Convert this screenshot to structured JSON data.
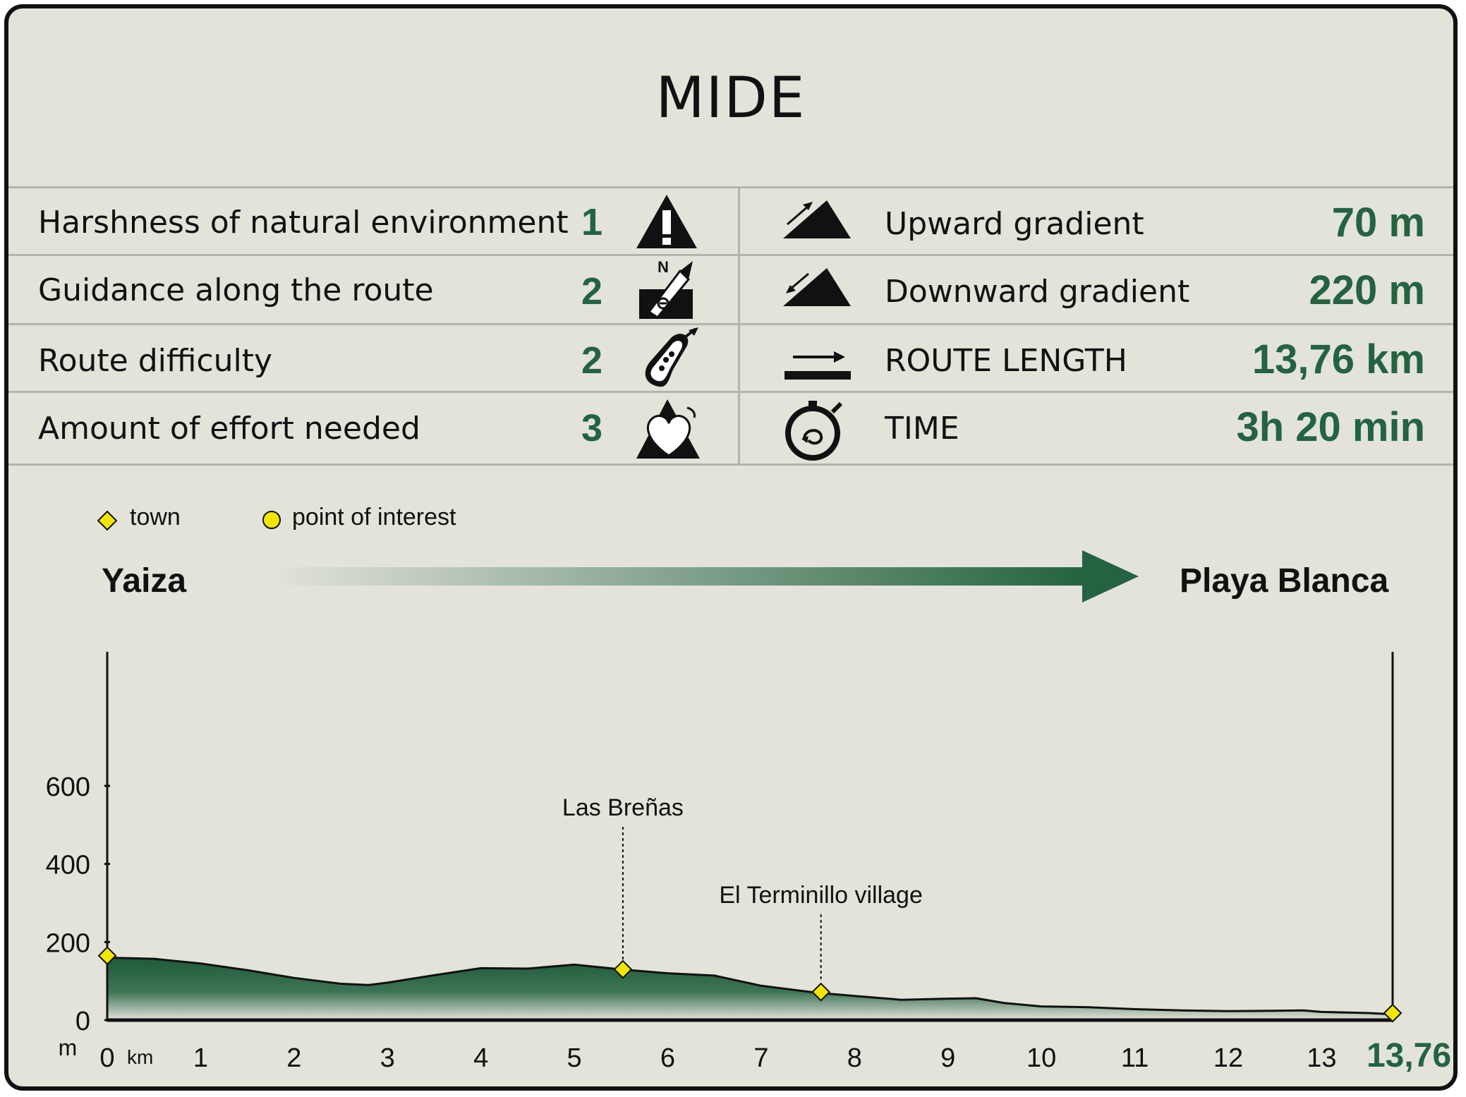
{
  "title": "MIDE",
  "mide_rows": [
    {
      "label": "Harshness of natural environment",
      "value": "1",
      "icon": "warning-triangle-icon"
    },
    {
      "label": "Guidance along the route",
      "value": "2",
      "icon": "compass-signpost-icon"
    },
    {
      "label": "Route difficulty",
      "value": "2",
      "icon": "footprint-icon"
    },
    {
      "label": "Amount of effort needed",
      "value": "3",
      "icon": "heart-mountain-icon"
    }
  ],
  "stats": [
    {
      "label": "Upward gradient",
      "value": "70 m",
      "icon": "upward-gradient-icon"
    },
    {
      "label": "Downward gradient",
      "value": "220 m",
      "icon": "downward-gradient-icon"
    },
    {
      "label": "ROUTE LENGTH",
      "value": "13,76 km",
      "icon": "route-length-icon"
    },
    {
      "label": "TIME",
      "value": "3h 20 min",
      "icon": "stopwatch-icon"
    }
  ],
  "legend": {
    "town": "town",
    "poi": "point of interest"
  },
  "route": {
    "start": "Yaiza",
    "end": "Playa Blanca"
  },
  "colors": {
    "accent": "#236341",
    "marker": "#f2e600",
    "background": "#e3e3da"
  },
  "chart_data": {
    "type": "area",
    "xlabel": "km",
    "ylabel": "m",
    "xlim": [
      0,
      13.76
    ],
    "ylim": [
      0,
      600
    ],
    "x_ticks": [
      "0",
      "1",
      "2",
      "3",
      "4",
      "5",
      "6",
      "7",
      "8",
      "9",
      "10",
      "11",
      "12",
      "13"
    ],
    "x_end_label": "13,76",
    "y_ticks": [
      "0",
      "200",
      "400",
      "600"
    ],
    "x": [
      0,
      0.5,
      1,
      1.5,
      2,
      2.5,
      2.8,
      3,
      3.5,
      4,
      4.5,
      5,
      5.5,
      6,
      6.5,
      7,
      7.6,
      8,
      8.5,
      9,
      9.3,
      9.6,
      10,
      10.5,
      11,
      11.5,
      12,
      12.5,
      12.8,
      13,
      13.5,
      13.76
    ],
    "y": [
      160,
      157,
      145,
      128,
      108,
      93,
      90,
      96,
      115,
      133,
      132,
      142,
      130,
      120,
      114,
      88,
      70,
      62,
      52,
      55,
      56,
      44,
      35,
      33,
      28,
      25,
      23,
      24,
      25,
      21,
      18,
      15
    ],
    "points": [
      {
        "x": 0,
        "y": 165,
        "type": "town",
        "label": ""
      },
      {
        "x": 5.52,
        "y": 130,
        "type": "town",
        "label": "Las Breñas"
      },
      {
        "x": 7.64,
        "y": 72,
        "type": "town",
        "label": "El Terminillo village"
      },
      {
        "x": 13.76,
        "y": 18,
        "type": "town",
        "label": ""
      }
    ]
  }
}
